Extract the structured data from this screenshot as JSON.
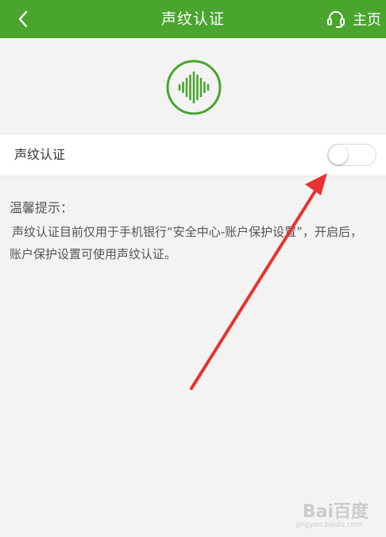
{
  "colors": {
    "header_bg": "#4aa52e",
    "accent": "#4aa52e",
    "page_bg": "#f3f3f3",
    "annotation_arrow": "#e8322f"
  },
  "header": {
    "back_icon": "chevron-left-icon",
    "title": "声纹认证",
    "home_icon": "headset-icon",
    "home_label": "主页"
  },
  "hero": {
    "icon": "voiceprint-waveform-icon"
  },
  "settings": {
    "voiceprint_label": "声纹认证",
    "voiceprint_enabled": false
  },
  "tip": {
    "title": "温馨提示：",
    "body": "声纹认证目前仅用于手机银行“安全中心-账户保护设置”，开启后，账户保护设置可使用声纹认证。"
  },
  "watermark": {
    "text": "Bai百度",
    "sub": "jingyan.baidu.com"
  }
}
